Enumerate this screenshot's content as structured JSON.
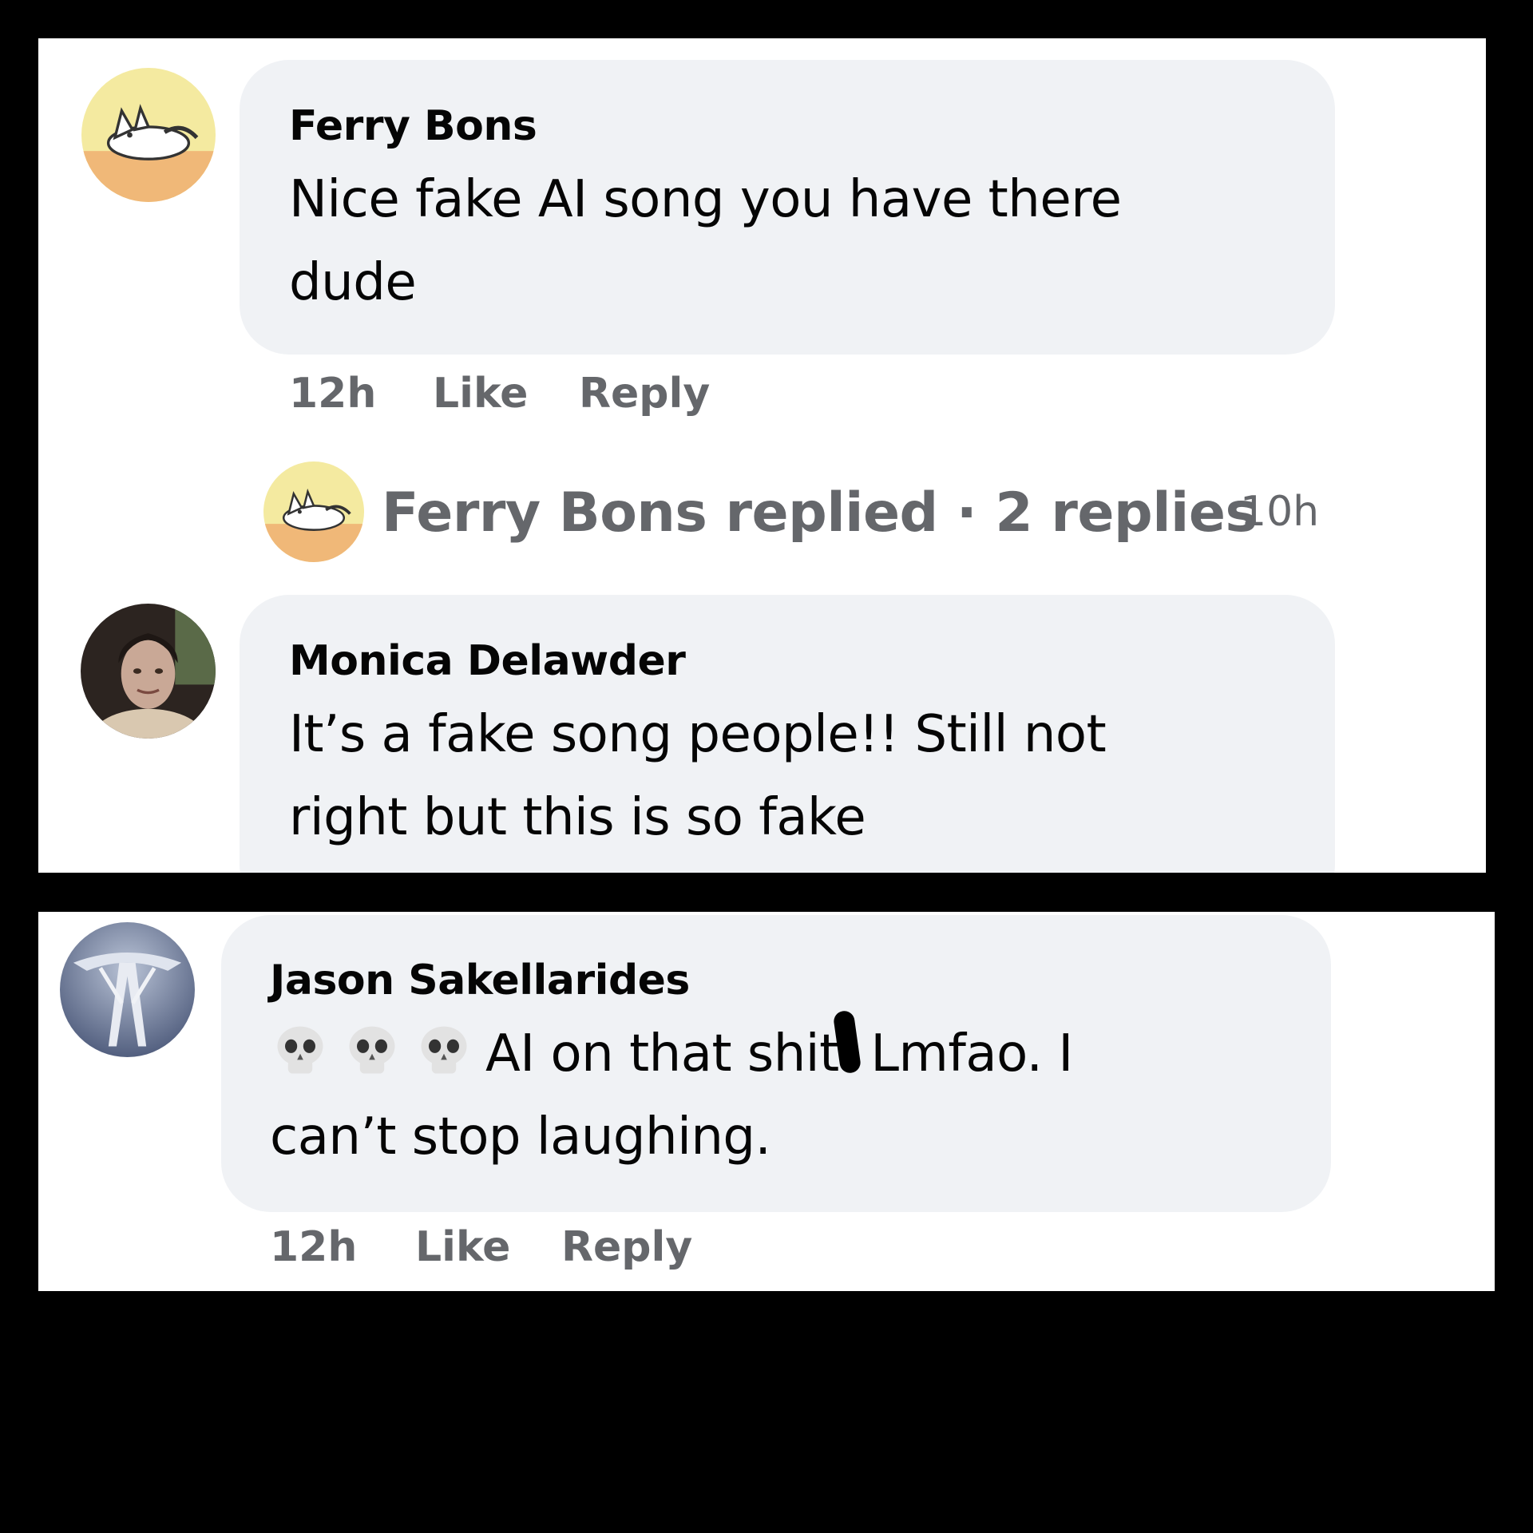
{
  "comments": [
    {
      "author": "Ferry Bons",
      "text_lines": [
        "Nice fake AI song you have there",
        "dude"
      ],
      "time": "12h",
      "like_label": "Like",
      "reply_label": "Reply",
      "replies_summary": {
        "label": "Ferry Bons replied · 2 replies",
        "time": "10h"
      }
    },
    {
      "author": "Monica Delawder",
      "text_lines": [
        "It’s a fake song people!! Still not",
        "right but this is so fake"
      ]
    },
    {
      "author": "Jason Sakellarides",
      "emoji_icons": [
        "skull-icon",
        "skull-icon",
        "skull-icon"
      ],
      "text_lines": [
        "AI on that sh",
        "it. Lmfao. I",
        "can’t stop laughing."
      ],
      "time": "12h",
      "like_label": "Like",
      "reply_label": "Reply"
    }
  ],
  "colors": {
    "page_background": "#000000",
    "panel_background": "#ffffff",
    "bubble_background": "#f0f2f5",
    "primary_text": "#050505",
    "secondary_text": "#65676b"
  }
}
